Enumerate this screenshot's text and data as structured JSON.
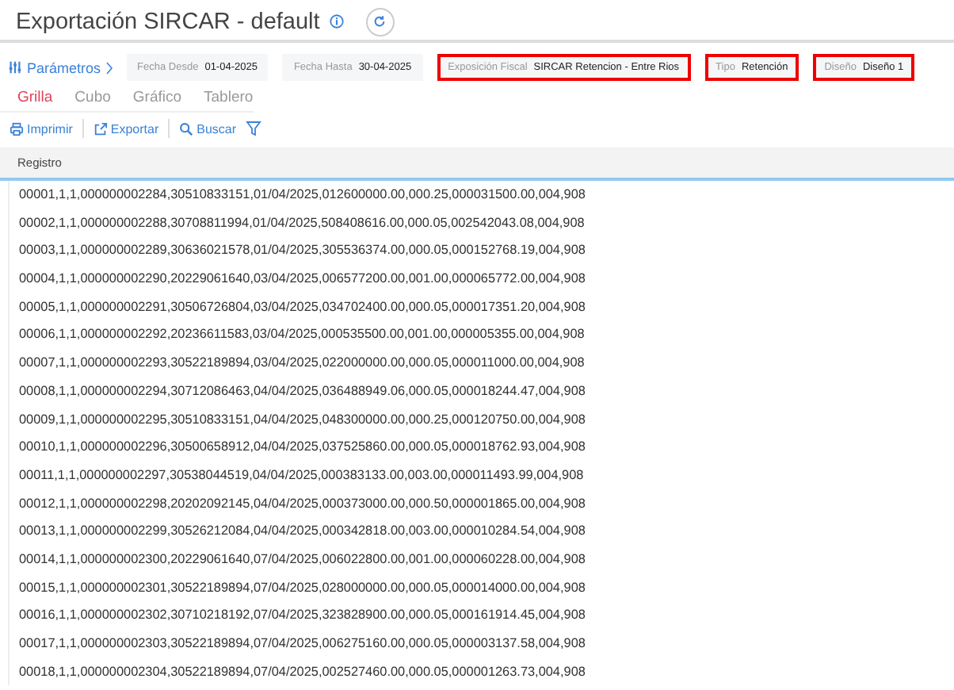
{
  "header": {
    "title": "Exportación SIRCAR - default"
  },
  "parameters": {
    "label": "Parámetros",
    "filters": [
      {
        "label": "Fecha Desde",
        "value": "01-04-2025",
        "highlighted": false
      },
      {
        "label": "Fecha Hasta",
        "value": "30-04-2025",
        "highlighted": false
      },
      {
        "label": "Exposición Fiscal",
        "value": "SIRCAR Retencion - Entre Rios",
        "highlighted": true
      },
      {
        "label": "Tipo",
        "value": "Retención",
        "highlighted": true
      },
      {
        "label": "Diseño",
        "value": "Diseño 1",
        "highlighted": true
      }
    ]
  },
  "tabs": [
    {
      "label": "Grilla",
      "selected": true
    },
    {
      "label": "Cubo",
      "selected": false
    },
    {
      "label": "Gráfico",
      "selected": false
    },
    {
      "label": "Tablero",
      "selected": false
    }
  ],
  "toolbar": [
    {
      "label": "Imprimir",
      "kind": "print"
    },
    {
      "label": "Exportar",
      "kind": "export"
    },
    {
      "label": "Buscar",
      "kind": "search"
    },
    {
      "kind": "filter"
    }
  ],
  "table": {
    "columns": [
      "Registro"
    ],
    "rows": [
      "00001,1,1,000000002284,30510833151,01/04/2025,012600000.00,000.25,000031500.00,004,908",
      "00002,1,1,000000002288,30708811994,01/04/2025,508408616.00,000.05,002542043.08,004,908",
      "00003,1,1,000000002289,30636021578,01/04/2025,305536374.00,000.05,000152768.19,004,908",
      "00004,1,1,000000002290,20229061640,03/04/2025,006577200.00,001.00,000065772.00,004,908",
      "00005,1,1,000000002291,30506726804,03/04/2025,034702400.00,000.05,000017351.20,004,908",
      "00006,1,1,000000002292,20236611583,03/04/2025,000535500.00,001.00,000005355.00,004,908",
      "00007,1,1,000000002293,30522189894,03/04/2025,022000000.00,000.05,000011000.00,004,908",
      "00008,1,1,000000002294,30712086463,04/04/2025,036488949.06,000.05,000018244.47,004,908",
      "00009,1,1,000000002295,30510833151,04/04/2025,048300000.00,000.25,000120750.00,004,908",
      "00010,1,1,000000002296,30500658912,04/04/2025,037525860.00,000.05,000018762.93,004,908",
      "00011,1,1,000000002297,30538044519,04/04/2025,000383133.00,003.00,000011493.99,004,908",
      "00012,1,1,000000002298,20202092145,04/04/2025,000373000.00,000.50,000001865.00,004,908",
      "00013,1,1,000000002299,30526212084,04/04/2025,000342818.00,003.00,000010284.54,004,908",
      "00014,1,1,000000002300,20229061640,07/04/2025,006022800.00,001.00,000060228.00,004,908",
      "00015,1,1,000000002301,30522189894,07/04/2025,028000000.00,000.05,000014000.00,004,908",
      "00016,1,1,000000002302,30710218192,07/04/2025,323828900.00,000.05,000161914.45,004,908",
      "00017,1,1,000000002303,30522189894,07/04/2025,006275160.00,000.05,000003137.58,004,908",
      "00018,1,1,000000002304,30522189894,07/04/2025,002527460.00,000.05,000001263.73,004,908"
    ]
  }
}
